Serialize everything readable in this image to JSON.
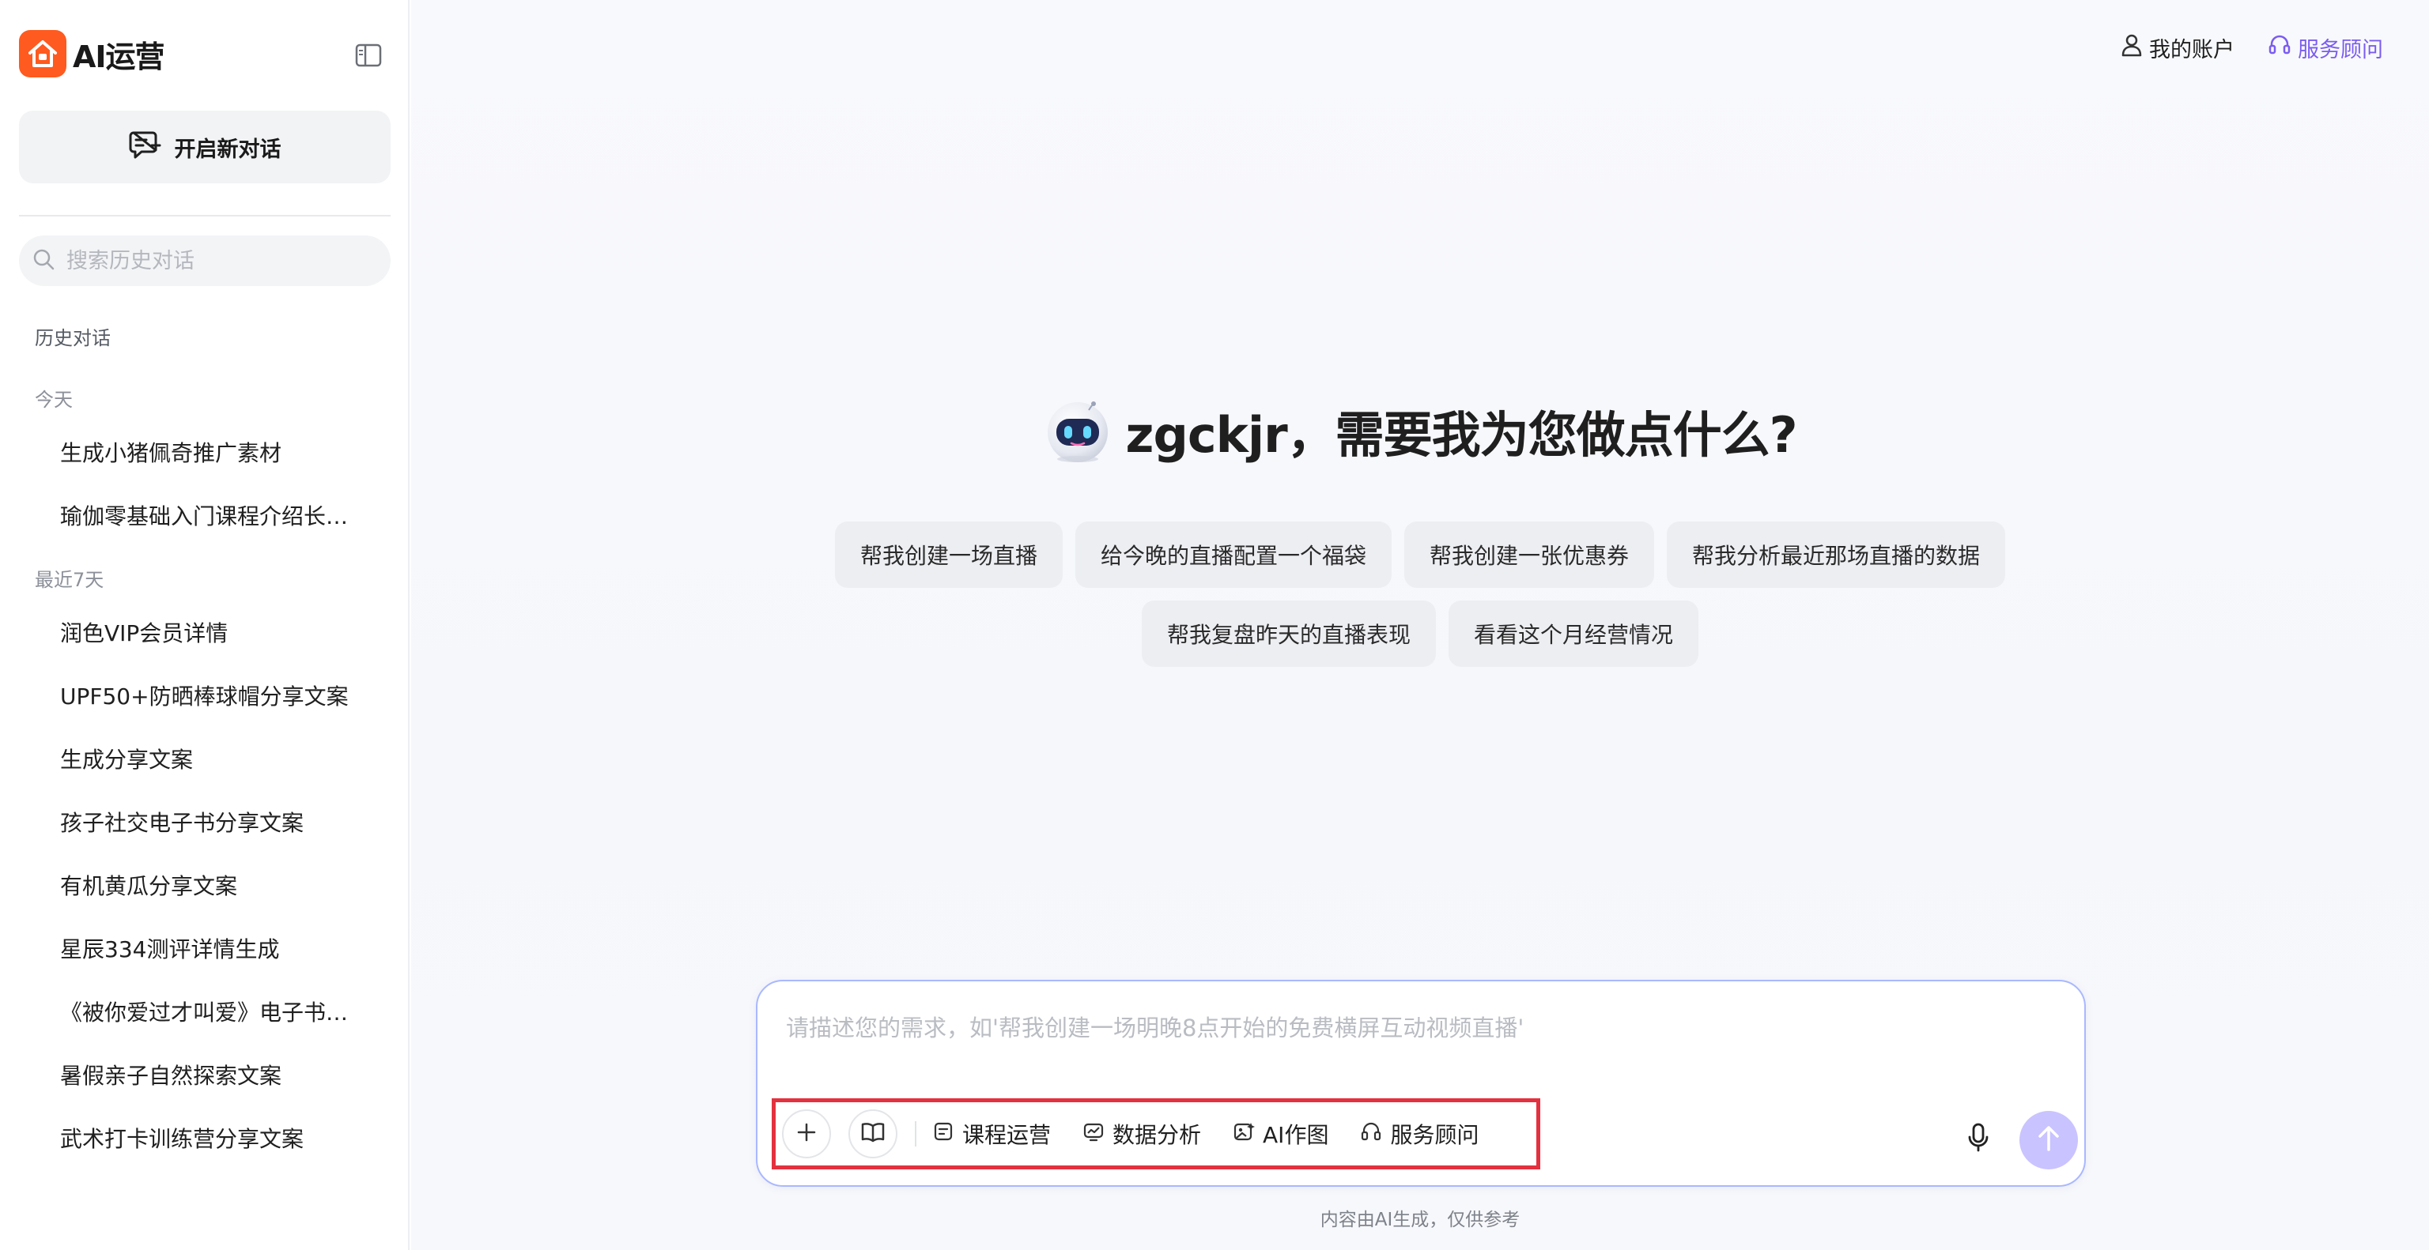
{
  "brand": {
    "name": "AI运营",
    "icon": "house-logo-icon"
  },
  "sidebar": {
    "new_chat_label": "开启新对话",
    "search_placeholder": "搜索历史对话",
    "history_title": "历史对话",
    "groups": [
      {
        "label": "今天",
        "items": [
          "生成小猪佩奇推广素材",
          "瑜伽零基础入门课程介绍长…"
        ]
      },
      {
        "label": "最近7天",
        "items": [
          "润色VIP会员详情",
          "UPF50+防晒棒球帽分享文案",
          "生成分享文案",
          "孩子社交电子书分享文案",
          "有机黄瓜分享文案",
          "星辰334测评详情生成",
          "《被你爱过才叫爱》电子书…",
          "暑假亲子自然探索文案",
          "武术打卡训练营分享文案"
        ]
      }
    ]
  },
  "header": {
    "account_label": "我的账户",
    "advisor_label": "服务顾问"
  },
  "hero": {
    "title": "zgckjr，需要我为您做点什么?"
  },
  "suggestions": {
    "row1": [
      "帮我创建一场直播",
      "给今晚的直播配置一个福袋",
      "帮我创建一张优惠券",
      "帮我分析最近那场直播的数据"
    ],
    "row2": [
      "帮我复盘昨天的直播表现",
      "看看这个月经营情况"
    ]
  },
  "composer": {
    "placeholder": "请描述您的需求，如'帮我创建一场明晚8点开始的免费横屏互动视频直播'",
    "tools": [
      "课程运营",
      "数据分析",
      "AI作图",
      "服务顾问"
    ]
  },
  "footer": {
    "note": "内容由AI生成，仅供参考"
  },
  "colors": {
    "brand": "#ff5a1f",
    "accent": "#7a5cf0",
    "composer_border": "#a9b8ff",
    "send_button": "#c9c3ff",
    "highlight_box": "#e3313f"
  }
}
